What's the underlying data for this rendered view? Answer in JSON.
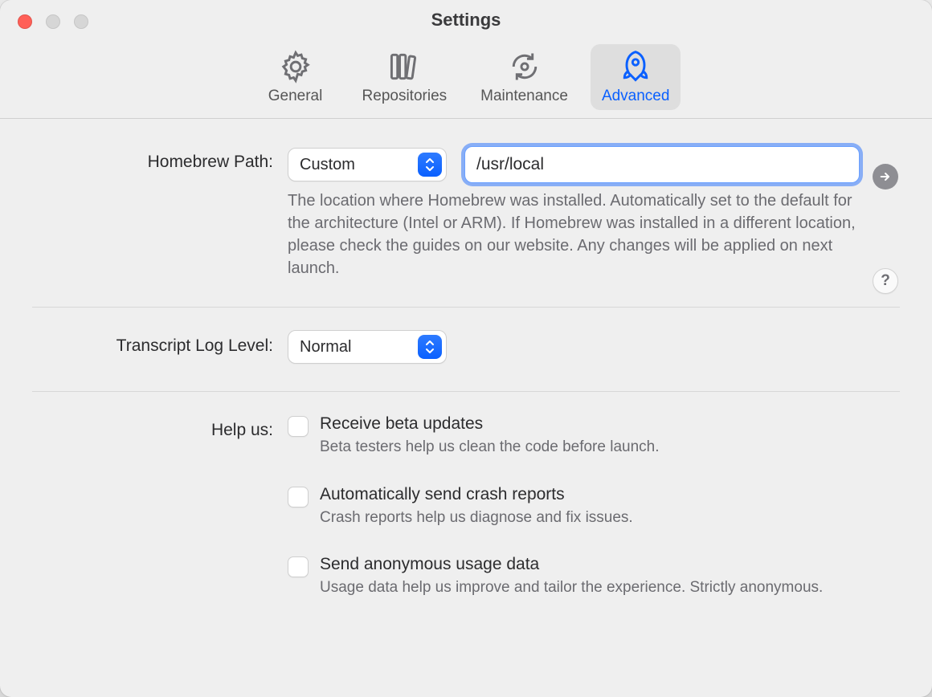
{
  "window": {
    "title": "Settings"
  },
  "tabs": {
    "general": "General",
    "repositories": "Repositories",
    "maintenance": "Maintenance",
    "advanced": "Advanced"
  },
  "homebrew": {
    "label": "Homebrew Path:",
    "select_value": "Custom",
    "path_value": "/usr/local",
    "description": "The location where Homebrew was installed. Automatically set to the default for the architecture (Intel or ARM). If Homebrew was installed in a different location, please check the guides on our website. Any changes will be applied on next launch."
  },
  "transcript": {
    "label": "Transcript Log Level:",
    "select_value": "Normal"
  },
  "helpus": {
    "label": "Help us:",
    "items": [
      {
        "title": "Receive beta updates",
        "desc": "Beta testers help us clean the code before launch."
      },
      {
        "title": "Automatically send crash reports",
        "desc": "Crash reports help us diagnose and fix issues."
      },
      {
        "title": "Send anonymous usage data",
        "desc": "Usage data help us improve and tailor the experience. Strictly anonymous."
      }
    ]
  },
  "icons": {
    "help_glyph": "?"
  }
}
